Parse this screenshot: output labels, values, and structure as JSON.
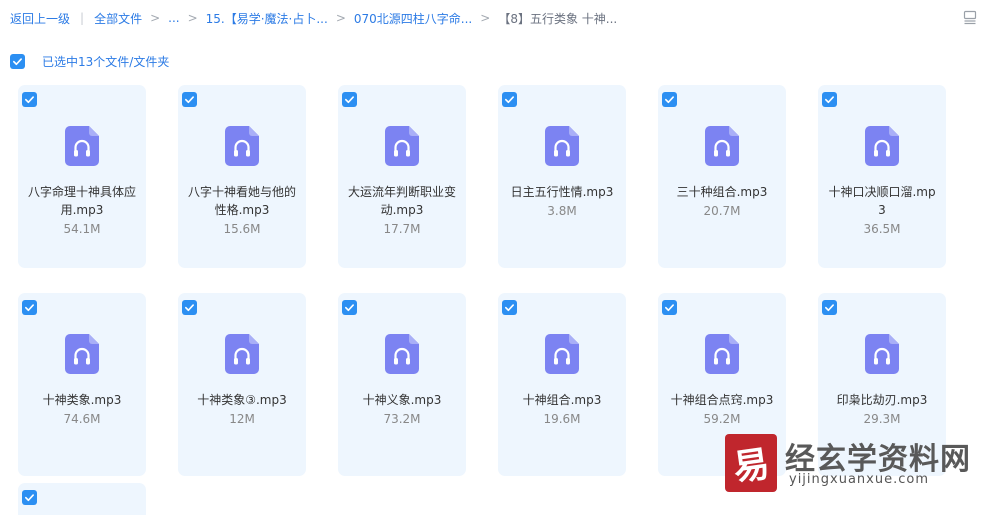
{
  "breadcrumb": {
    "back": "返回上一级",
    "all_files": "全部文件",
    "ellipsis": "...",
    "folder1": "15.【易学·魔法·占卜...",
    "folder2": "070北源四柱八字命...",
    "current": "【8】五行类象 十神..."
  },
  "selection": {
    "text": "已选中13个文件/文件夹"
  },
  "files": [
    {
      "name": "八字命理十神具体应用.mp3",
      "size": "54.1M"
    },
    {
      "name": "八字十神看她与他的性格.mp3",
      "size": "15.6M"
    },
    {
      "name": "大运流年判断职业变动.mp3",
      "size": "17.7M"
    },
    {
      "name": "日主五行性情.mp3",
      "size": "3.8M"
    },
    {
      "name": "三十种组合.mp3",
      "size": "20.7M"
    },
    {
      "name": "十神口决顺口溜.mp3",
      "size": "36.5M"
    },
    {
      "name": "十神类象.mp3",
      "size": "74.6M"
    },
    {
      "name": "十神类象③.mp3",
      "size": "12M"
    },
    {
      "name": "十神义象.mp3",
      "size": "73.2M"
    },
    {
      "name": "十神组合.mp3",
      "size": "19.6M"
    },
    {
      "name": "十神组合点窍.mp3",
      "size": "59.2M"
    },
    {
      "name": "印枭比劫刃.mp3",
      "size": "29.3M"
    }
  ],
  "watermark": {
    "logo_char": "易",
    "title": "经玄学资料网",
    "url": "yijingxuanxue.com"
  },
  "colors": {
    "accent": "#2c8ff2",
    "link": "#2c7be5",
    "card_bg": "#eef6fe",
    "icon": "#7c83f2"
  },
  "icons": {
    "check": "checkbox-checked-icon",
    "file": "audio-file-icon",
    "view": "list-view-icon"
  }
}
